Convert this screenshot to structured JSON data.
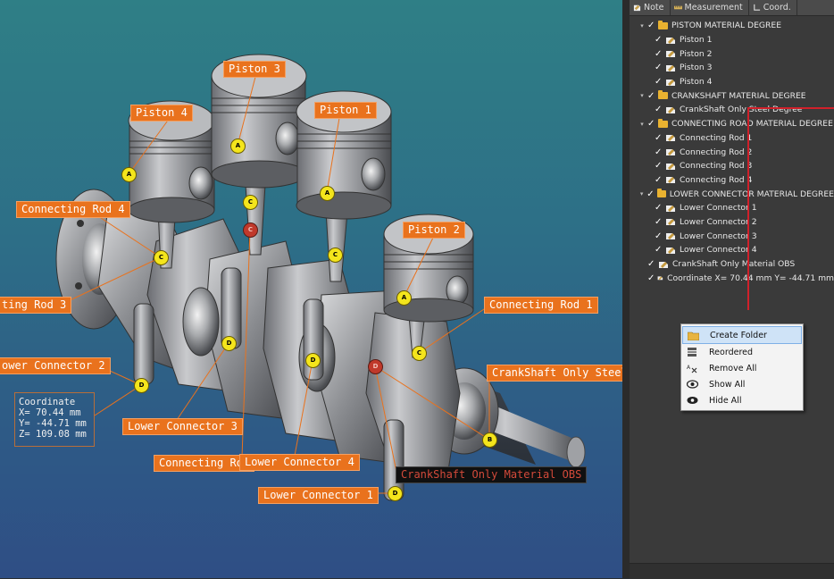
{
  "panel": {
    "tabs": [
      {
        "label": "Note",
        "icon": "note-icon"
      },
      {
        "label": "Measurement",
        "icon": "ruler-icon"
      },
      {
        "label": "Coord.",
        "icon": "coordinate-icon"
      }
    ],
    "tree": [
      {
        "type": "folder",
        "label": "PISTON MATERIAL DEGREE",
        "children": [
          "Piston 1",
          "Piston 2",
          "Piston 3",
          "Piston 4"
        ]
      },
      {
        "type": "folder",
        "label": "CRANKSHAFT MATERIAL DEGREE",
        "children": [
          "CrankShaft Only Steel Degree"
        ]
      },
      {
        "type": "folder",
        "label": "CONNECTING ROAD MATERIAL DEGREE",
        "children": [
          "Connecting Rod 1",
          "Connecting Rod 2",
          "Connecting Rod 3",
          "Connecting Rod 4"
        ]
      },
      {
        "type": "folder",
        "label": "LOWER CONNECTOR MATERIAL DEGREE",
        "children": [
          "Lower Connector 1",
          "Lower Connector 2",
          "Lower Connector 3",
          "Lower Connector 4"
        ]
      },
      {
        "type": "note",
        "label": "CrankShaft Only Material OBS"
      },
      {
        "type": "note",
        "label": "Coordinate  X= 70.44 mm  Y= -44.71 mm"
      }
    ]
  },
  "context_menu": {
    "items": [
      {
        "label": "Create Folder",
        "icon": "folder-icon",
        "active": true
      },
      {
        "label": "Reordered",
        "icon": "reorder-icon",
        "active": false
      },
      {
        "label": "Remove All",
        "icon": "remove-all-icon",
        "active": false
      },
      {
        "label": "Show All",
        "icon": "eye-icon",
        "active": false
      },
      {
        "label": "Hide All",
        "icon": "eye-closed-icon",
        "active": false
      }
    ]
  },
  "viewport": {
    "callouts": {
      "piston3": "Piston 3",
      "piston4": "Piston 4",
      "piston1": "Piston 1",
      "piston2": "Piston 2",
      "rod4": "Connecting Rod 4",
      "rod3": "ting Rod 3",
      "rod1": "Connecting Rod 1",
      "rod_bottom": "Connecting Rod",
      "lower2": "ower Connector 2",
      "lower3": "Lower Connector 3",
      "lower4": "Lower Connector 4",
      "lower1": "Lower Connector 1",
      "crank_steel": "CrankShaft Only Steel",
      "crank_obs": "CrankShaft Only Material OBS"
    },
    "coordinate": {
      "title": "Coordinate",
      "x": "X= 70.44 mm",
      "y": "Y= -44.71 mm",
      "z": "Z= 109.08 mm"
    },
    "markers": {
      "a": "A",
      "b": "B",
      "c": "C",
      "d": "D"
    }
  }
}
